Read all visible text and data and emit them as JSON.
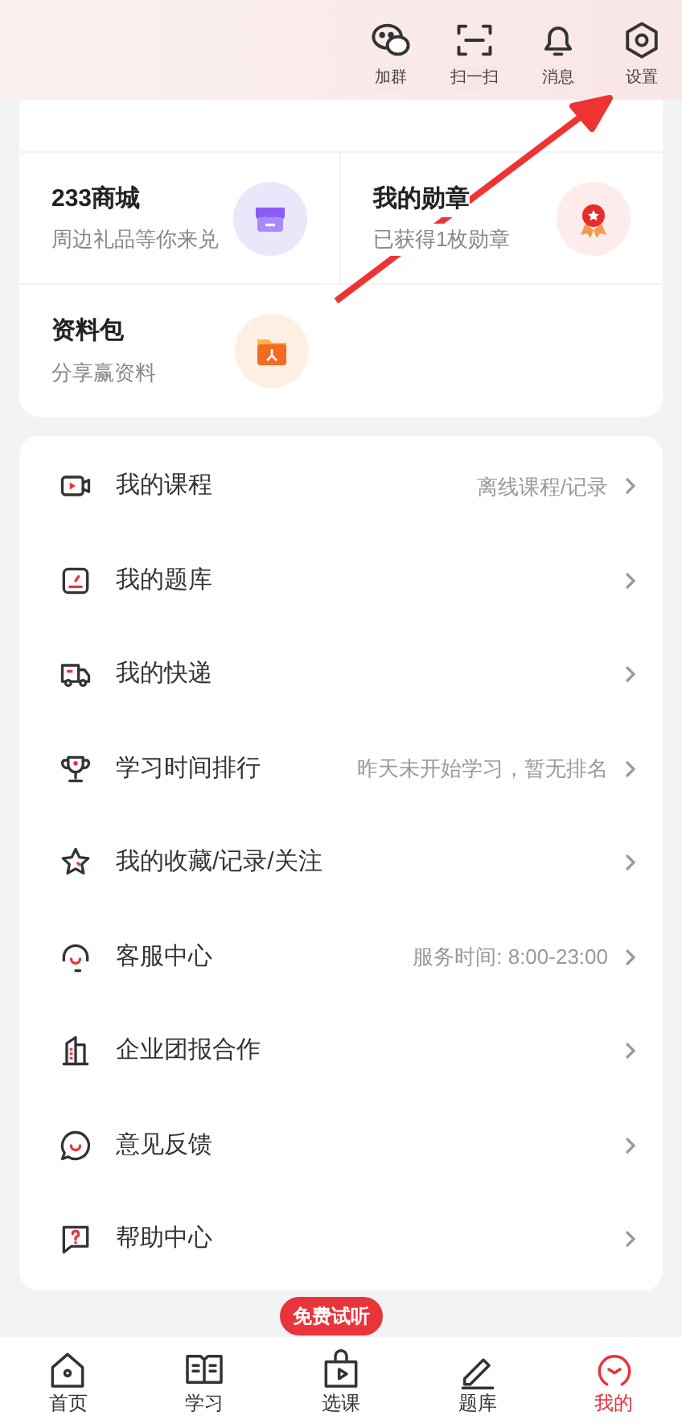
{
  "header": {
    "actions": [
      {
        "label": "加群"
      },
      {
        "label": "扫一扫"
      },
      {
        "label": "消息"
      },
      {
        "label": "设置"
      }
    ]
  },
  "services": [
    {
      "title": "233商城",
      "subtitle": "周边礼品等你来兑"
    },
    {
      "title": "我的勋章",
      "subtitle": "已获得1枚勋章"
    },
    {
      "title": "资料包",
      "subtitle": "分享赢资料"
    }
  ],
  "menu": [
    {
      "label": "我的课程",
      "hint": "离线课程/记录"
    },
    {
      "label": "我的题库"
    },
    {
      "label": "我的快递"
    },
    {
      "label": "学习时间排行",
      "hint": "昨天未开始学习，暂无排名"
    },
    {
      "label": "我的收藏/记录/关注"
    },
    {
      "label": "客服中心",
      "hint": "服务时间: 8:00-23:00"
    },
    {
      "label": "企业团报合作"
    },
    {
      "label": "意见反馈"
    },
    {
      "label": "帮助中心"
    }
  ],
  "promo_badge": "免费试听",
  "tabs": [
    {
      "label": "首页",
      "selected": false
    },
    {
      "label": "学习",
      "selected": false
    },
    {
      "label": "选课",
      "selected": false
    },
    {
      "label": "题库",
      "selected": false
    },
    {
      "label": "我的",
      "selected": true
    }
  ]
}
